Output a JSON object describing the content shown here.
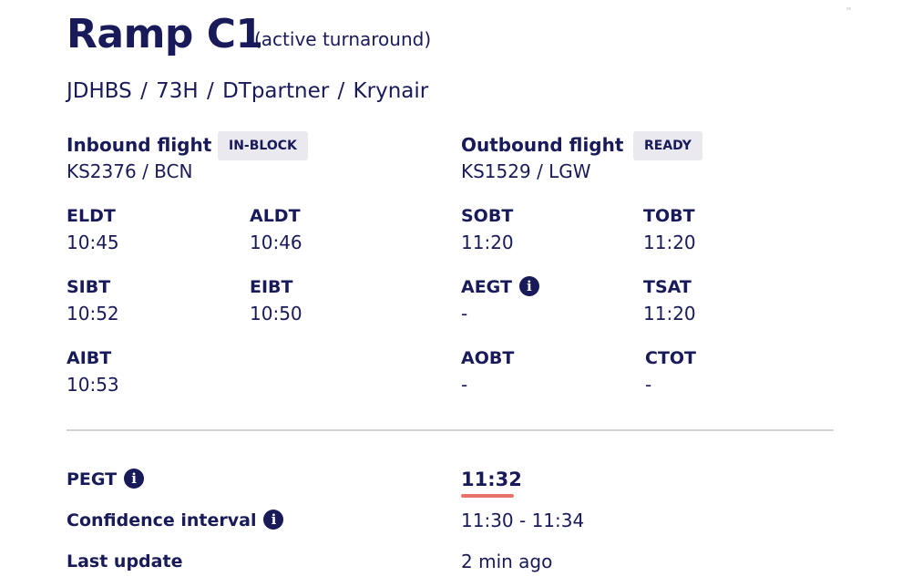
{
  "ramp": {
    "title": "Ramp C1",
    "subtitle": "(active turnaround)",
    "meta": "JDHBS  /  73H  /  DTpartner  /  Krynair"
  },
  "inbound": {
    "header": "Inbound flight",
    "status": "IN-BLOCK",
    "route": "KS2376  /  BCN",
    "times": {
      "eldt": {
        "label": "ELDT",
        "value": "10:45"
      },
      "aldt": {
        "label": "ALDT",
        "value": "10:46"
      },
      "sibt": {
        "label": "SIBT",
        "value": "10:52"
      },
      "eibt": {
        "label": "EIBT",
        "value": "10:50"
      },
      "aibt": {
        "label": "AIBT",
        "value": "10:53"
      }
    }
  },
  "outbound": {
    "header": "Outbound flight",
    "status": "READY",
    "route": "KS1529  /  LGW",
    "times": {
      "sobt": {
        "label": "SOBT",
        "value": "11:20"
      },
      "tobt": {
        "label": "TOBT",
        "value": "11:20"
      },
      "aegt": {
        "label": "AEGT",
        "value": "-"
      },
      "tsat": {
        "label": "TSAT",
        "value": "11:20"
      },
      "aobt": {
        "label": "AOBT",
        "value": "-"
      },
      "ctot": {
        "label": "CTOT",
        "value": "-"
      }
    }
  },
  "prediction": {
    "pegt_label": "PEGT",
    "pegt_value": "11:32",
    "confidence_label": "Confidence interval",
    "confidence_value": "11:30 - 11:34",
    "last_update_label": "Last update",
    "last_update_value": "2 min ago"
  },
  "icons": {
    "info": "info-icon"
  },
  "colors": {
    "text": "#181a5a",
    "badge_bg": "#e9e9ef",
    "pegt_underline": "#e8716a",
    "divider": "#d2d2d8"
  }
}
